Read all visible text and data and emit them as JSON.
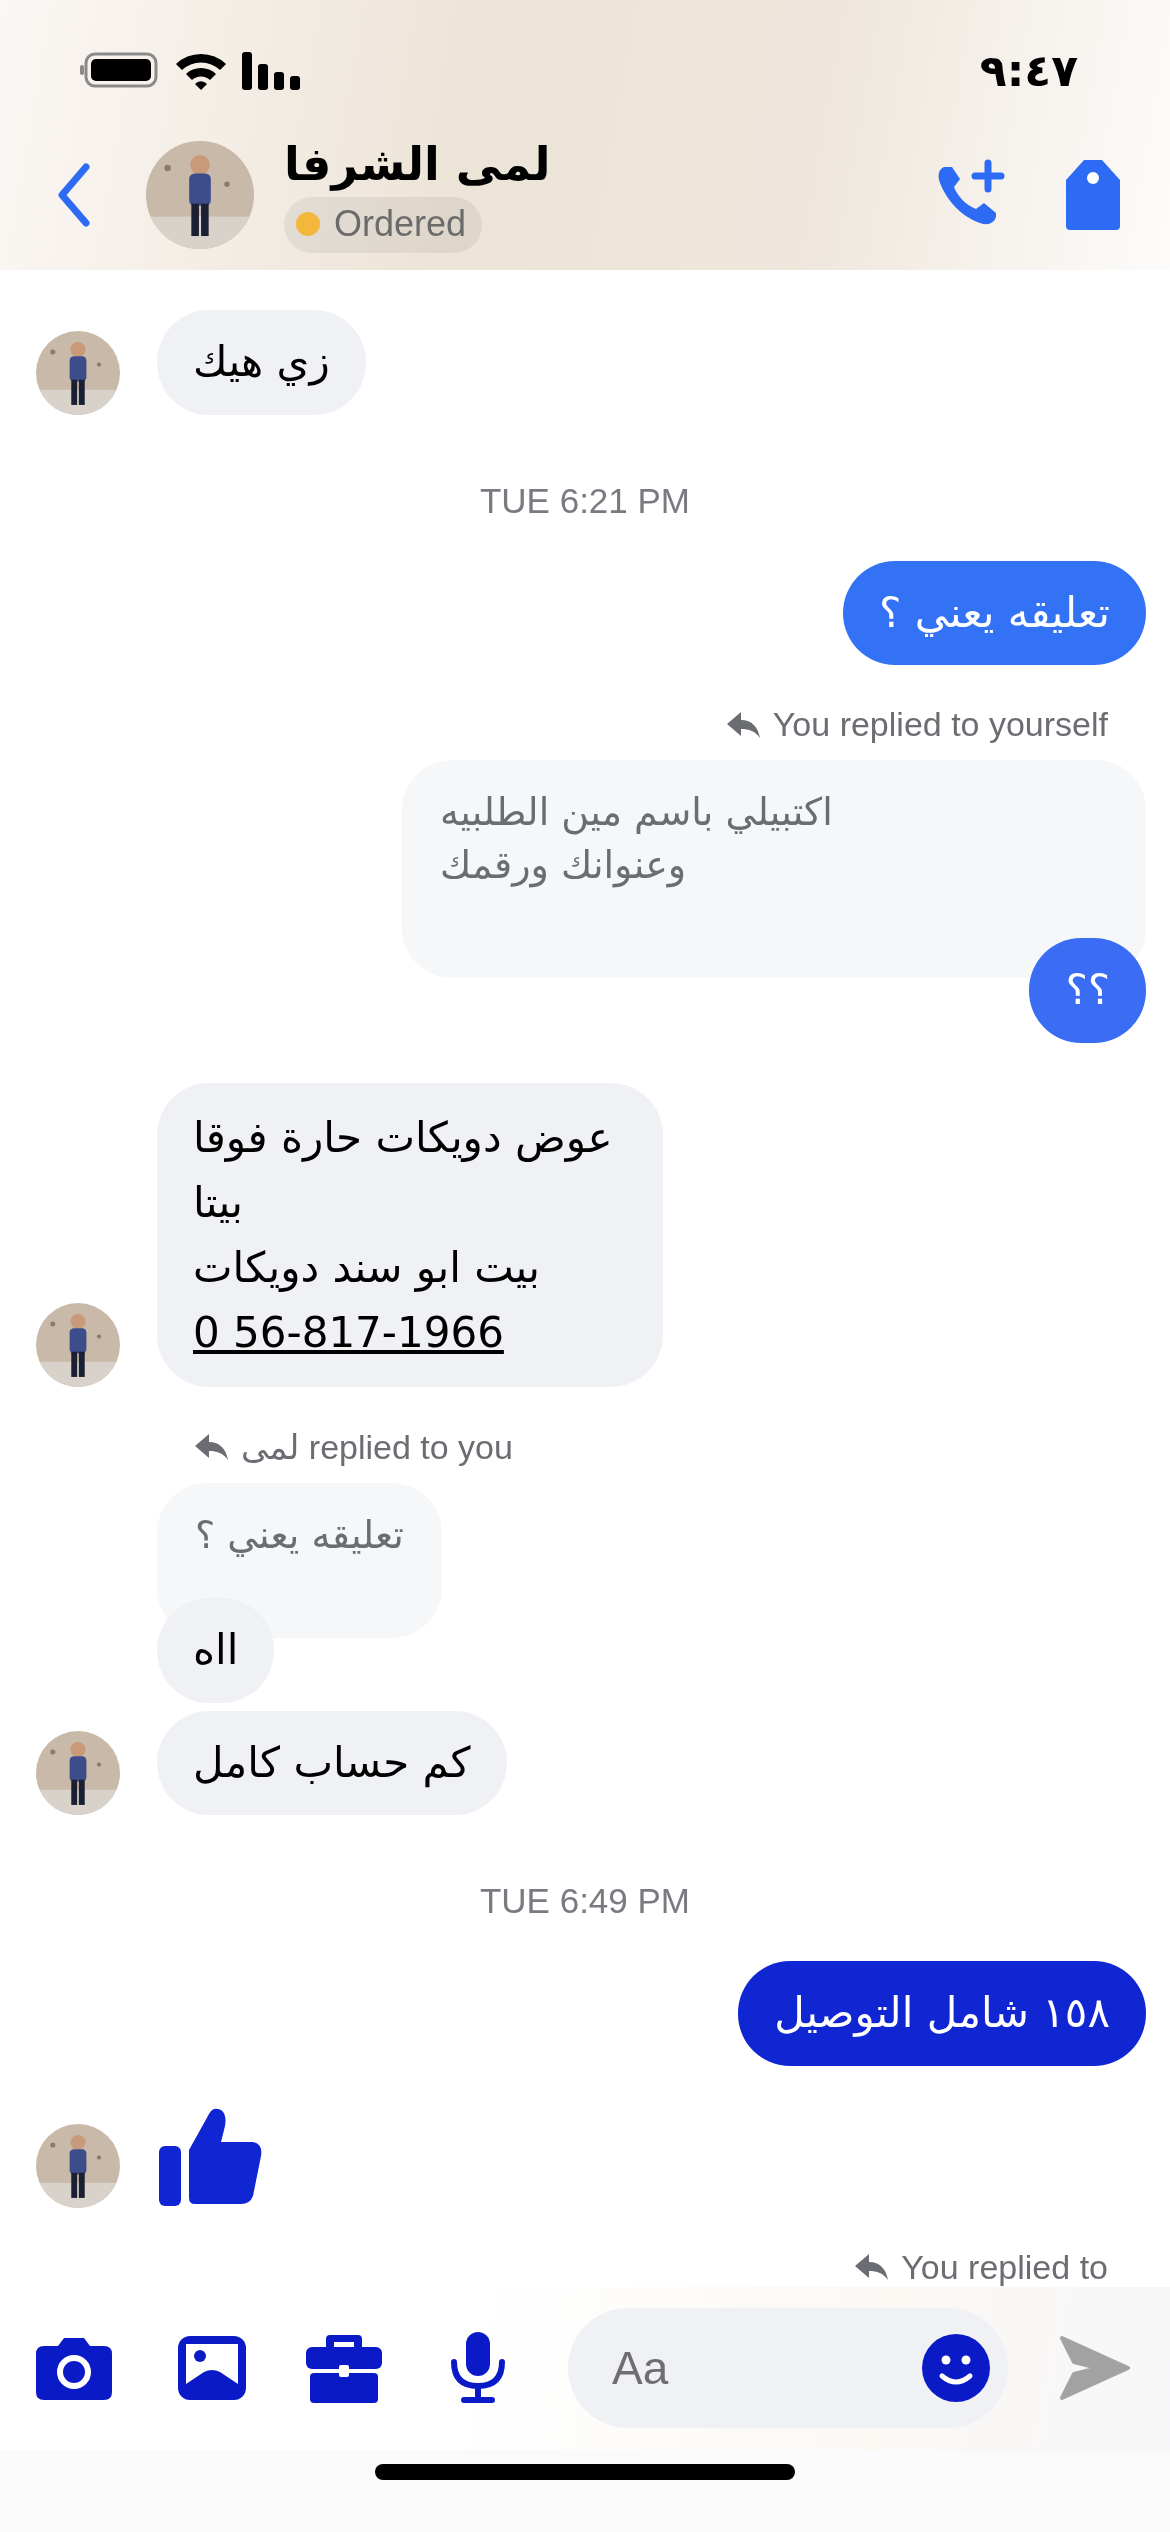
{
  "status_bar": {
    "time": "٩:٤٧"
  },
  "header": {
    "name": "لمى الشرفا",
    "status": {
      "label": "Ordered",
      "color": "#f4b73d"
    }
  },
  "messages": [
    {
      "kind": "incoming",
      "text": "زي هيك",
      "avatar": true
    },
    {
      "kind": "timestamp",
      "text": "TUE 6:21 PM"
    },
    {
      "kind": "outgoing",
      "text": "تعليقه يعني ؟",
      "color": "#3371f5"
    },
    {
      "kind": "reply_out",
      "text": "You replied to yourself"
    },
    {
      "kind": "quote_out",
      "text": "اكتبيلي باسم مين الطلبيه\nوعنوانك ورقمك"
    },
    {
      "kind": "outgoing",
      "text": "؟؟",
      "color": "#3a6cf4"
    },
    {
      "kind": "incoming",
      "text": "عوض دويكات حارة فوقا\nبيتا\nبيت ابو سند دويكات",
      "link": "0 56-817-1966",
      "avatar": true
    },
    {
      "kind": "reply_in",
      "text": "لمى replied to you"
    },
    {
      "kind": "quote_in",
      "text": "تعليقه يعني ؟"
    },
    {
      "kind": "incoming",
      "text": "ااه",
      "avatar": false
    },
    {
      "kind": "incoming",
      "text": "كم حساب كامل",
      "avatar": true
    },
    {
      "kind": "timestamp",
      "text": "TUE 6:49 PM"
    },
    {
      "kind": "outgoing",
      "text": "١٥٨ شامل التوصيل",
      "color": "#1126d3"
    },
    {
      "kind": "like",
      "avatar": true
    },
    {
      "kind": "reply_out",
      "text": "You replied to"
    }
  ],
  "composer": {
    "placeholder": "Aa"
  }
}
